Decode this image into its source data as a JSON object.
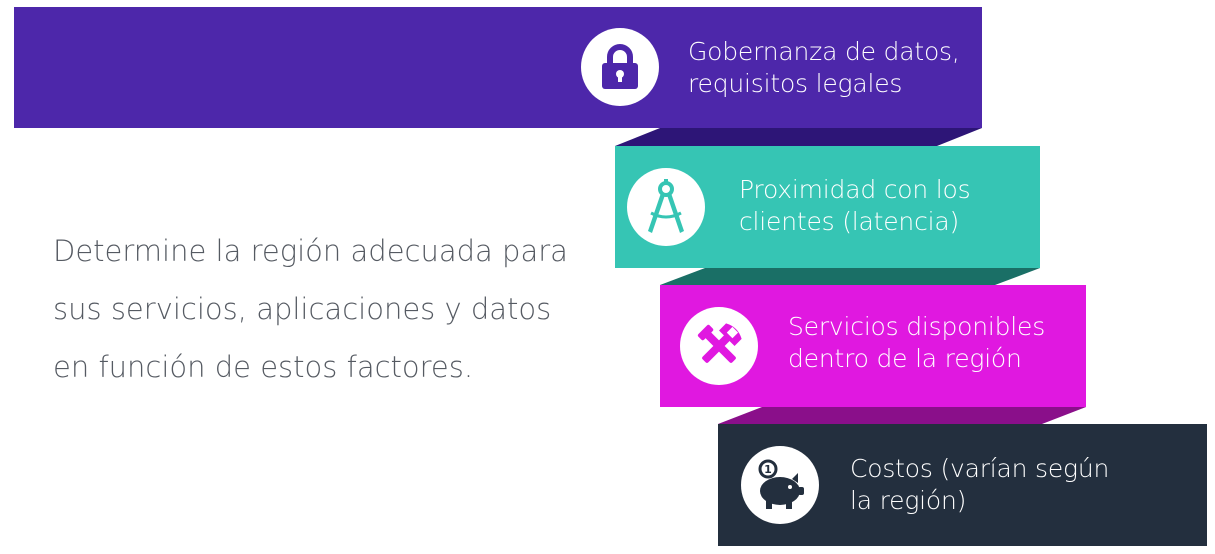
{
  "intro": {
    "line1": "Determine la región adecuada para",
    "line2": "sus servicios, aplicaciones y datos",
    "line3": "en función de estos factores."
  },
  "factors": [
    {
      "line1": "Gobernanza de datos,",
      "line2": "requisitos legales",
      "icon": "lock-icon",
      "color": "#4d27aa"
    },
    {
      "line1": "Proximidad con los",
      "line2": "clientes (latencia)",
      "icon": "compass-icon",
      "color": "#36c5b4"
    },
    {
      "line1": "Servicios disponibles",
      "line2": "dentro de la región",
      "icon": "tools-icon",
      "color": "#e018e0"
    },
    {
      "line1": "Costos (varían según",
      "line2": "la región)",
      "icon": "piggy-bank-icon",
      "color": "#232f3e"
    }
  ],
  "colors": {
    "fold_purple": "#2d1577",
    "fold_teal": "#1a6f66",
    "fold_magenta": "#8a0f8a",
    "text_gray": "#555a62"
  }
}
